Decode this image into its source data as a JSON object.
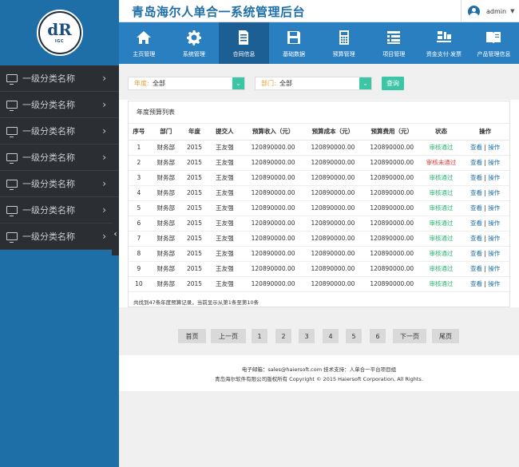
{
  "app": {
    "title": "青岛海尔人单合一系统管理后台",
    "logo_letters": "dR",
    "logo_sub": "IGC",
    "user": "admin"
  },
  "sidebar": {
    "items": [
      {
        "label": "一级分类名称"
      },
      {
        "label": "一级分类名称"
      },
      {
        "label": "一级分类名称"
      },
      {
        "label": "一级分类名称"
      },
      {
        "label": "一级分类名称"
      },
      {
        "label": "一级分类名称"
      },
      {
        "label": "一级分类名称"
      }
    ],
    "collapse_glyph": "‹"
  },
  "nav": {
    "items": [
      {
        "label": "主页管理",
        "icon": "home-icon"
      },
      {
        "label": "系统管理",
        "icon": "gear-icon"
      },
      {
        "label": "合同信息",
        "icon": "document-icon",
        "active": true
      },
      {
        "label": "基础数据",
        "icon": "save-icon"
      },
      {
        "label": "预算管理",
        "icon": "calculator-icon"
      },
      {
        "label": "项目管理",
        "icon": "list-icon"
      },
      {
        "label": "资金支付·发票",
        "icon": "payment-icon"
      },
      {
        "label": "产品管理信息",
        "icon": "book-icon"
      }
    ]
  },
  "filters": {
    "year_label": "年度:",
    "year_value": "全部",
    "dept_label": "部门:",
    "dept_value": "全部",
    "query_button": "查询"
  },
  "table": {
    "title": "年度预算列表",
    "headers": [
      "序号",
      "部门",
      "年度",
      "提交人",
      "预算收入（元）",
      "预算成本（元）",
      "预算费用（元）",
      "状态",
      "操作"
    ],
    "view_label": "查看",
    "op_label": "操作",
    "rows": [
      {
        "no": "1",
        "dept": "财务部",
        "year": "2015",
        "submitter": "王友强",
        "income": "120890000.00",
        "cost": "120890000.00",
        "expense": "120890000.00",
        "status": "审核通过",
        "status_ok": true
      },
      {
        "no": "2",
        "dept": "财务部",
        "year": "2015",
        "submitter": "王友强",
        "income": "120890000.00",
        "cost": "120890000.00",
        "expense": "120890000.00",
        "status": "审核未通过",
        "status_ok": false
      },
      {
        "no": "3",
        "dept": "财务部",
        "year": "2015",
        "submitter": "王友强",
        "income": "120890000.00",
        "cost": "120890000.00",
        "expense": "120890000.00",
        "status": "审核通过",
        "status_ok": true
      },
      {
        "no": "4",
        "dept": "财务部",
        "year": "2015",
        "submitter": "王友强",
        "income": "120890000.00",
        "cost": "120890000.00",
        "expense": "120890000.00",
        "status": "审核通过",
        "status_ok": true
      },
      {
        "no": "5",
        "dept": "财务部",
        "year": "2015",
        "submitter": "王友强",
        "income": "120890000.00",
        "cost": "120890000.00",
        "expense": "120890000.00",
        "status": "审核通过",
        "status_ok": true
      },
      {
        "no": "6",
        "dept": "财务部",
        "year": "2015",
        "submitter": "王友强",
        "income": "120890000.00",
        "cost": "120890000.00",
        "expense": "120890000.00",
        "status": "审核通过",
        "status_ok": true
      },
      {
        "no": "7",
        "dept": "财务部",
        "year": "2015",
        "submitter": "王友强",
        "income": "120890000.00",
        "cost": "120890000.00",
        "expense": "120890000.00",
        "status": "审核通过",
        "status_ok": true
      },
      {
        "no": "8",
        "dept": "财务部",
        "year": "2015",
        "submitter": "王友强",
        "income": "120890000.00",
        "cost": "120890000.00",
        "expense": "120890000.00",
        "status": "审核通过",
        "status_ok": true
      },
      {
        "no": "9",
        "dept": "财务部",
        "year": "2015",
        "submitter": "王友强",
        "income": "120890000.00",
        "cost": "120890000.00",
        "expense": "120890000.00",
        "status": "审核通过",
        "status_ok": true
      },
      {
        "no": "10",
        "dept": "财务部",
        "year": "2015",
        "submitter": "王友强",
        "income": "120890000.00",
        "cost": "120890000.00",
        "expense": "120890000.00",
        "status": "审核通过",
        "status_ok": true
      }
    ],
    "summary": "共找到47条年度预算记录，当前显示从第1条至第10条"
  },
  "pagination": {
    "buttons": [
      "首页",
      "上一页",
      "1",
      "2",
      "3",
      "4",
      "5",
      "6",
      "下一页",
      "尾页"
    ]
  },
  "footer": {
    "line1": "电子邮箱：sales@haiersoft.com  技术支持：人单合一平台项目组",
    "line2": "青岛海尔软件有限公司版权所有 Copyright © 2015 Haiersoft Corporation, All Rights."
  },
  "colors": {
    "brand_blue": "#1e6fa8",
    "nav_blue": "#2a7fc0",
    "accent_green": "#3cc6a5",
    "sidebar_dark": "#2b2f33",
    "status_ok": "#2bb573",
    "status_bad": "#e03c3c"
  }
}
